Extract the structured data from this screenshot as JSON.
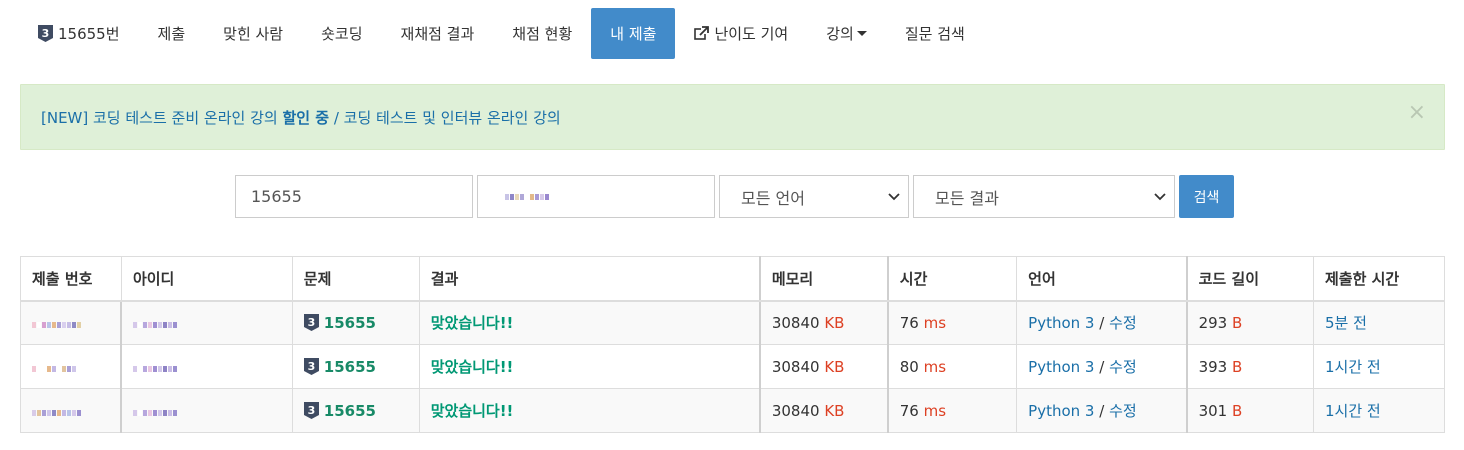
{
  "nav": {
    "problem_tab": "15655번",
    "tier_badge_number": "3",
    "tabs": [
      "제출",
      "맞힌 사람",
      "숏코딩",
      "재채점 결과",
      "채점 현황"
    ],
    "active_tab": "내 제출",
    "contribute_tab": "난이도 기여",
    "lecture_tab": "강의",
    "question_tab": "질문 검색"
  },
  "alert": {
    "prefix": "[NEW] 코딩 테스트 준비 온라인 강의 ",
    "bold": "할인 중",
    "suffix": " / 코딩 테스트 및 인터뷰 온라인 강의",
    "close": "×"
  },
  "search": {
    "problem_value": "15655",
    "language_selected": "모든 언어",
    "result_selected": "모든 결과",
    "button": "검색"
  },
  "table": {
    "headers": [
      "제출 번호",
      "아이디",
      "문제",
      "결과",
      "메모리",
      "시간",
      "언어",
      "코드 길이",
      "제출한 시간"
    ],
    "rows": [
      {
        "problem": "15655",
        "result": "맞았습니다!!",
        "memory": "30840",
        "memory_unit": "KB",
        "time": "76",
        "time_unit": "ms",
        "language": "Python 3",
        "edit": "수정",
        "code_length": "293",
        "code_unit": "B",
        "submitted": "5분 전"
      },
      {
        "problem": "15655",
        "result": "맞았습니다!!",
        "memory": "30840",
        "memory_unit": "KB",
        "time": "80",
        "time_unit": "ms",
        "language": "Python 3",
        "edit": "수정",
        "code_length": "393",
        "code_unit": "B",
        "submitted": "1시간 전"
      },
      {
        "problem": "15655",
        "result": "맞았습니다!!",
        "memory": "30840",
        "memory_unit": "KB",
        "time": "76",
        "time_unit": "ms",
        "language": "Python 3",
        "edit": "수정",
        "code_length": "301",
        "code_unit": "B",
        "submitted": "1시간 전"
      }
    ]
  },
  "colors": {
    "primary": "#428bca",
    "accepted": "#009874",
    "unit": "#dd4124",
    "link": "#1a6fa8",
    "alert_bg": "#dff0d8",
    "tier_badge": "#3f4b62"
  },
  "icons": {
    "tier": "tier-badge-icon",
    "external": "external-link-icon",
    "dropdown": "caret-down-icon",
    "select": "chevron-down-icon",
    "close": "close-icon"
  }
}
